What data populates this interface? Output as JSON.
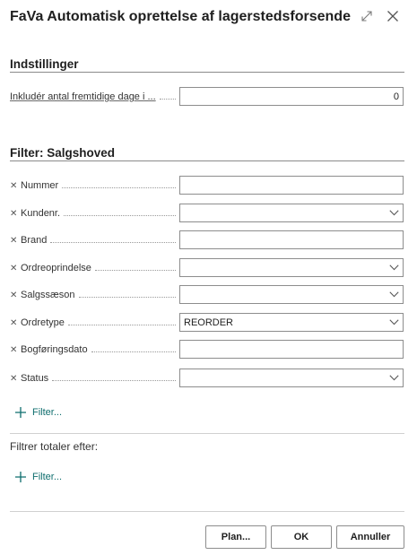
{
  "dialog": {
    "title": "FaVa Automatisk oprettelse af lagerstedsforsende..."
  },
  "settings": {
    "title": "Indstillinger",
    "field": {
      "label": "Inkludér antal fremtidige dage i ...",
      "value": "0"
    }
  },
  "filter": {
    "title": "Filter: Salgshoved",
    "fields": [
      {
        "label": "Nummer",
        "value": "",
        "dropdown": false
      },
      {
        "label": "Kundenr.",
        "value": "",
        "dropdown": true
      },
      {
        "label": "Brand",
        "value": "",
        "dropdown": false
      },
      {
        "label": "Ordreoprindelse",
        "value": "",
        "dropdown": true
      },
      {
        "label": "Salgssæson",
        "value": "",
        "dropdown": true
      },
      {
        "label": "Ordretype",
        "value": "REORDER",
        "dropdown": true
      },
      {
        "label": "Bogføringsdato",
        "value": "",
        "dropdown": false
      },
      {
        "label": "Status",
        "value": "",
        "dropdown": true
      }
    ],
    "add_filter_label": "Filter..."
  },
  "totals": {
    "title": "Filtrer totaler efter:",
    "add_filter_label": "Filter..."
  },
  "buttons": {
    "plan": "Plan...",
    "ok": "OK",
    "cancel": "Annuller"
  },
  "colors": {
    "link": "#0f6e6e",
    "border": "#8d8d8d"
  }
}
